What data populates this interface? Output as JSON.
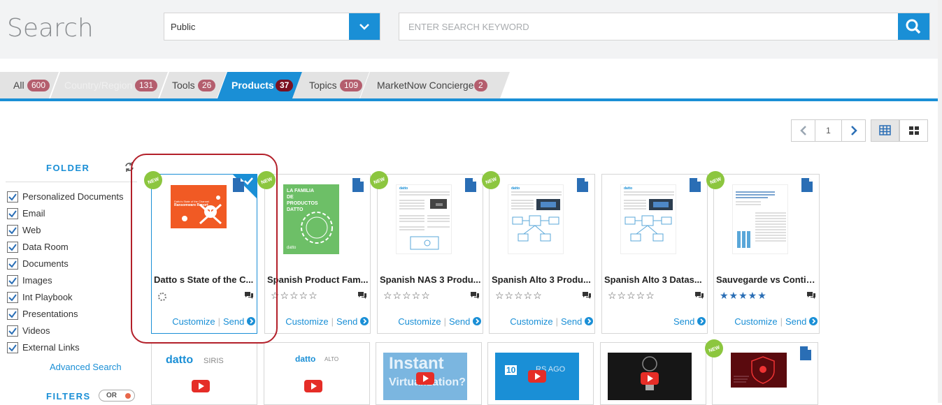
{
  "header": {
    "title": "Search",
    "scope_value": "Public",
    "search_placeholder": "ENTER SEARCH KEYWORD"
  },
  "tabs": [
    {
      "label": "All",
      "count": "600"
    },
    {
      "label": "Country/Region",
      "count": "131"
    },
    {
      "label": "Tools",
      "count": "26"
    },
    {
      "label": "Products",
      "count": "37",
      "active": true
    },
    {
      "label": "Topics",
      "count": "109"
    },
    {
      "label": "MarketNow Concierge",
      "count": "2"
    }
  ],
  "pager": {
    "page": "1"
  },
  "sidebar": {
    "folder_title": "FOLDER",
    "items": [
      {
        "label": "Personalized Documents",
        "checked": true
      },
      {
        "label": "Email",
        "checked": true
      },
      {
        "label": "Web",
        "checked": true
      },
      {
        "label": "Data Room",
        "checked": true
      },
      {
        "label": "Documents",
        "checked": true
      },
      {
        "label": "Images",
        "checked": true
      },
      {
        "label": "Int Playbook",
        "checked": true
      },
      {
        "label": "Presentations",
        "checked": true
      },
      {
        "label": "Videos",
        "checked": true
      },
      {
        "label": "External Links",
        "checked": true
      }
    ],
    "advanced_search": "Advanced Search",
    "filters_title": "FILTERS",
    "filters_toggle": "OR"
  },
  "cards": [
    {
      "title": "Datto s State of the C...",
      "customize": "Customize",
      "send": "Send",
      "stars": "",
      "new": true,
      "selected": true,
      "thumb_heading": "Datto's State of the Channel",
      "thumb_subheading": "Ransomware Report"
    },
    {
      "title": "Spanish Product Fam...",
      "customize": "Customize",
      "send": "Send",
      "stars": "☆☆☆☆☆",
      "new": true,
      "thumb_heading": "LA FAMILIA DE PRODUCTOS DATTO",
      "thumb_logo": "datto"
    },
    {
      "title": "Spanish NAS 3 Produ...",
      "customize": "Customize",
      "send": "Send",
      "stars": "☆☆☆☆☆",
      "new": true,
      "thumb_logo": "datto"
    },
    {
      "title": "Spanish Alto 3 Produ...",
      "customize": "Customize",
      "send": "Send",
      "stars": "☆☆☆☆☆",
      "new": true,
      "thumb_logo": "datto"
    },
    {
      "title": "Spanish Alto 3 Datas...",
      "customize": "",
      "send": "Send",
      "stars": "☆☆☆☆☆",
      "new": false,
      "thumb_logo": "datto"
    },
    {
      "title": "Sauvegarde vs Contin...",
      "customize": "Customize",
      "send": "Send",
      "stars": "★★★★★",
      "new": true
    }
  ],
  "row2": [
    {
      "logo": "datto",
      "sub": "SIRIS"
    },
    {
      "logo": "datto",
      "sub": "ALTO"
    },
    {
      "logo": "Instant",
      "sub": "Virtualization?"
    },
    {
      "logo": "10",
      "sub": "RS AGO"
    },
    {
      "logo": "",
      "sub": ""
    },
    {
      "logo": "",
      "sub": "",
      "new": true
    }
  ],
  "colors": {
    "accent": "#1a8fd6",
    "badge": "#b45e6e",
    "highlight": "#b3202a",
    "new_badge": "#8cc63f"
  }
}
